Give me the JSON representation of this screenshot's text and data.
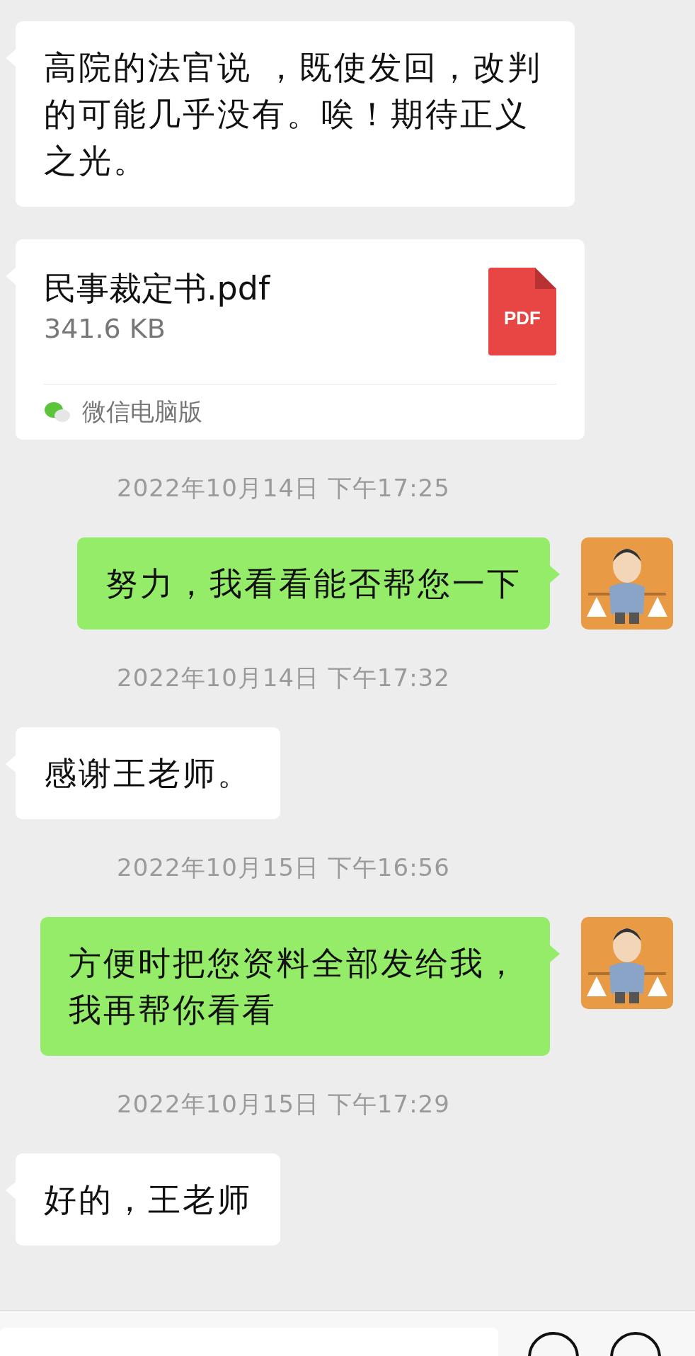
{
  "messages": [
    {
      "kind": "text",
      "outgoing": false,
      "text": "高院的法官说 ，既使发回，改判的可能几乎没有。唉！期待正义之光。"
    },
    {
      "kind": "file",
      "outgoing": false,
      "file_name": "民事裁定书.pdf",
      "size": "341.6 KB",
      "file_type": "PDF",
      "source": "微信电脑版"
    },
    {
      "kind": "time",
      "text": "2022年10月14日 下午17:25"
    },
    {
      "kind": "text",
      "outgoing": true,
      "text": "努力，我看看能否帮您一下"
    },
    {
      "kind": "time",
      "text": "2022年10月14日 下午17:32"
    },
    {
      "kind": "text",
      "outgoing": false,
      "text": "感谢王老师。"
    },
    {
      "kind": "time",
      "text": "2022年10月15日 下午16:56"
    },
    {
      "kind": "text",
      "outgoing": true,
      "text": "方便时把您资料全部发给我，我再帮你看看"
    },
    {
      "kind": "time",
      "text": "2022年10月15日 下午17:29"
    },
    {
      "kind": "text",
      "outgoing": false,
      "text": "好的，王老师"
    }
  ]
}
